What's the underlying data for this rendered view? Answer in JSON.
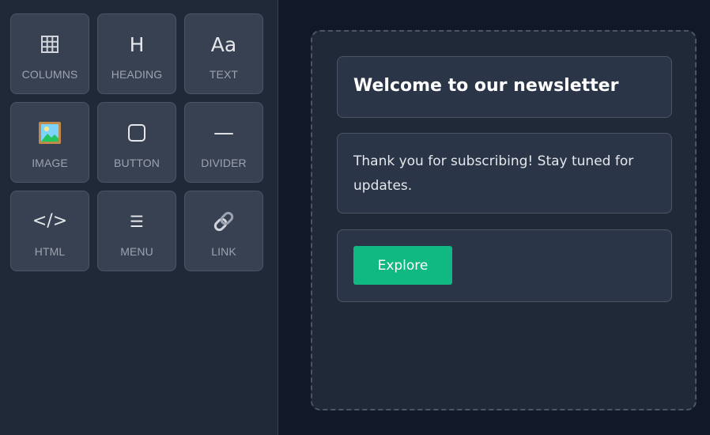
{
  "sidebar": {
    "blocks": [
      {
        "label": "COLUMNS",
        "icon": "columns-grid-icon"
      },
      {
        "label": "HEADING",
        "icon": "heading-icon",
        "glyph": "H"
      },
      {
        "label": "TEXT",
        "icon": "text-icon",
        "glyph": "Aa"
      },
      {
        "label": "IMAGE",
        "icon": "image-icon"
      },
      {
        "label": "BUTTON",
        "icon": "button-icon"
      },
      {
        "label": "DIVIDER",
        "icon": "divider-icon",
        "glyph": "—"
      },
      {
        "label": "HTML",
        "icon": "code-icon",
        "glyph": "</>"
      },
      {
        "label": "MENU",
        "icon": "menu-icon",
        "glyph": "☰"
      },
      {
        "label": "LINK",
        "icon": "link-icon"
      }
    ]
  },
  "canvas": {
    "heading": "Welcome to our newsletter",
    "text": "Thank you for subscribing! Stay tuned for updates.",
    "button_label": "Explore"
  },
  "colors": {
    "background": "#111827",
    "sidebar": "#1f2937",
    "block": "#374151",
    "card": "#2a3547",
    "accent": "#10b981"
  }
}
